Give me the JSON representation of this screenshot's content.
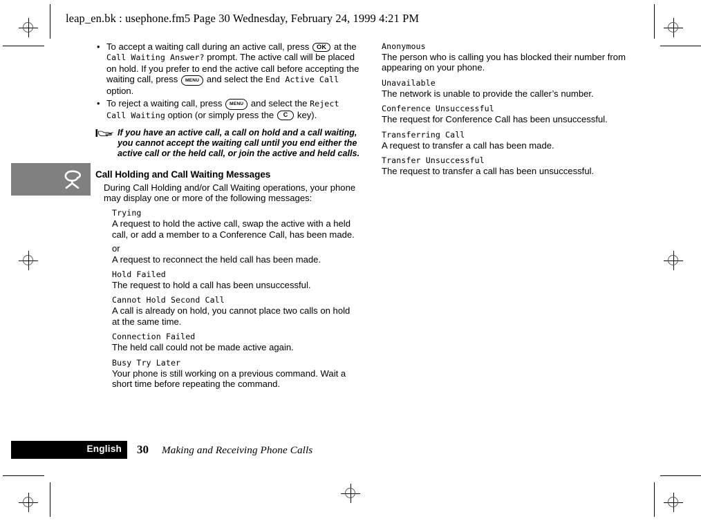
{
  "header": {
    "text": "leap_en.bk : usephone.fm5  Page 30  Wednesday, February 24, 1999  4:21 PM"
  },
  "chapter_tab": {
    "icon": "phone-handset-icon",
    "color": "#808080"
  },
  "left_column": {
    "bullets": [
      {
        "segments": [
          {
            "type": "text",
            "value": "To accept a waiting call during an active call, press "
          },
          {
            "type": "key",
            "value": "OK"
          },
          {
            "type": "text",
            "value": " at the "
          },
          {
            "type": "lcd",
            "value": "Call Waiting Answer?"
          },
          {
            "type": "text",
            "value": " prompt. The active call will be placed on hold. If you prefer to end the active call before accepting the waiting call, press "
          },
          {
            "type": "key",
            "value": "MENU"
          },
          {
            "type": "text",
            "value": " and select the "
          },
          {
            "type": "lcd",
            "value": "End Active Call"
          },
          {
            "type": "text",
            "value": " option."
          }
        ]
      },
      {
        "segments": [
          {
            "type": "text",
            "value": "To reject a waiting call, press "
          },
          {
            "type": "key",
            "value": "MENU"
          },
          {
            "type": "text",
            "value": " and select the "
          },
          {
            "type": "lcd",
            "value": "Reject Call Waiting"
          },
          {
            "type": "text",
            "value": " option (or simply press the "
          },
          {
            "type": "key",
            "value": "C"
          },
          {
            "type": "text",
            "value": " key)."
          }
        ]
      }
    ],
    "note": {
      "icon": "pointing-hand-icon",
      "text": "If you have an active call, a call on hold and a call waiting, you cannot accept the waiting call until you end either the active call or the held call, or join the active and held calls."
    },
    "section_heading": "Call Holding and Call Waiting Messages",
    "section_intro": "During Call Holding and/or Call Waiting operations, your phone may display one or more of the following messages:",
    "messages": [
      {
        "term": "Trying",
        "def": "A request to hold the active call, swap the active with a held call, or add a member to a Conference Call, has been made.",
        "or_label": "or",
        "def2": "A request to reconnect the held call has been made."
      },
      {
        "term": "Hold Failed",
        "def": "The request to hold a call has been unsuccessful."
      },
      {
        "term": "Cannot Hold Second Call",
        "def": "A call is already on hold, you cannot place two calls on hold at the same time."
      },
      {
        "term": "Connection Failed",
        "def": "The held call could not be made active again."
      },
      {
        "term": "Busy Try Later",
        "def": "Your phone is still working on a previous command. Wait a short time before repeating the command."
      }
    ]
  },
  "right_column": {
    "messages": [
      {
        "term": "Anonymous",
        "def": "The person who is calling you has blocked their number from appearing on your phone."
      },
      {
        "term": "Unavailable",
        "def": "The network is unable to provide the caller’s number."
      },
      {
        "term": "Conference Unsuccessful",
        "def": "The request for Conference Call has been unsuccessful."
      },
      {
        "term": "Transferring Call",
        "def": "A request to transfer a call has been made."
      },
      {
        "term": "Transfer Unsuccessful",
        "def": "The request to transfer a call has been unsuccessful."
      }
    ]
  },
  "footer": {
    "language": "English",
    "page_number": "30",
    "chapter_title": "Making and Receiving Phone Calls",
    "bar_color": "#000000"
  }
}
